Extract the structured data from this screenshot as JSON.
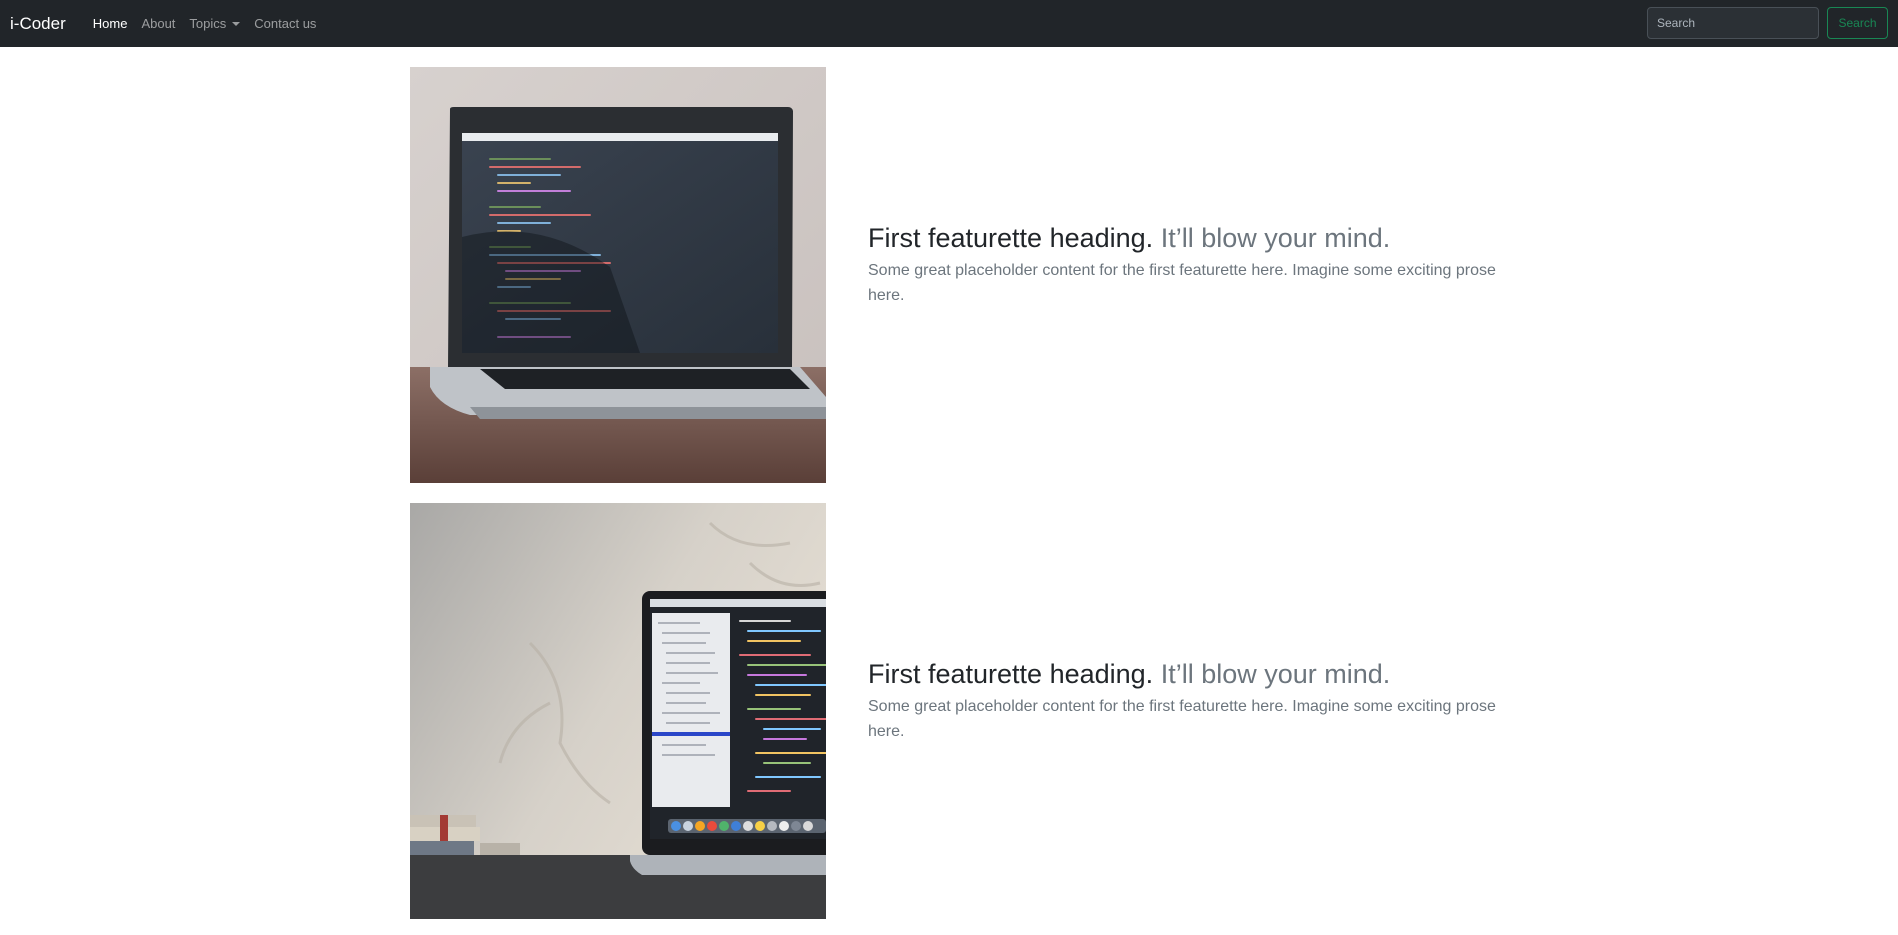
{
  "navbar": {
    "brand": "i-Coder",
    "links": [
      {
        "label": "Home",
        "active": true
      },
      {
        "label": "About",
        "active": false
      },
      {
        "label": "Topics",
        "active": false,
        "dropdown": true
      },
      {
        "label": "Contact us",
        "active": false
      }
    ],
    "search": {
      "placeholder": "Search",
      "button_label": "Search"
    }
  },
  "featurettes": [
    {
      "heading": "First featurette heading.",
      "heading_muted": "It’ll blow your mind.",
      "body": "Some great placeholder content for the first featurette here. Imagine some exciting prose here.",
      "image": "laptop-on-desk-photo"
    },
    {
      "heading": "First featurette heading.",
      "heading_muted": "It’ll blow your mind.",
      "body": "Some great placeholder content for the first featurette here. Imagine some exciting prose here.",
      "image": "macbook-code-editor-photo"
    }
  ],
  "colors": {
    "navbar_bg": "#212529",
    "success": "#198754",
    "muted_text": "#6c757d"
  }
}
